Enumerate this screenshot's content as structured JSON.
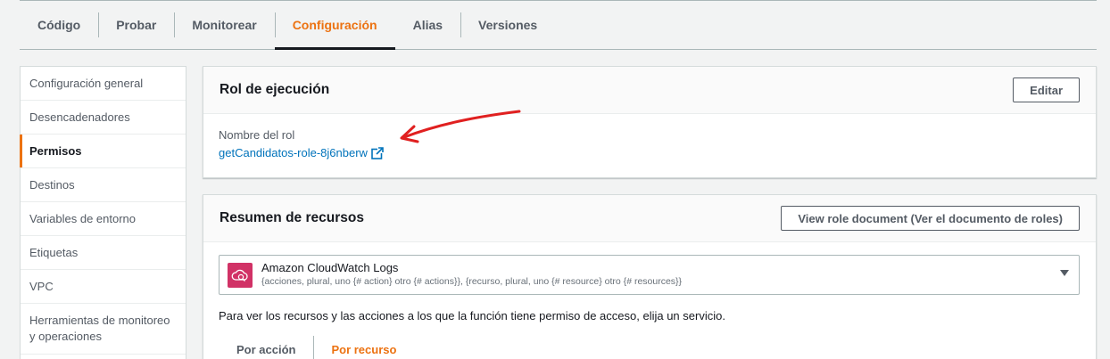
{
  "tabs": [
    "Código",
    "Probar",
    "Monitorear",
    "Configuración",
    "Alias",
    "Versiones"
  ],
  "active_tab": "Configuración",
  "sidebar": {
    "items": [
      "Configuración general",
      "Desencadenadores",
      "Permisos",
      "Destinos",
      "Variables de entorno",
      "Etiquetas",
      "VPC",
      "Herramientas de monitoreo y operaciones"
    ],
    "active": "Permisos"
  },
  "role_panel": {
    "title": "Rol de ejecución",
    "edit_label": "Editar",
    "role_name_label": "Nombre del rol",
    "role_name": "getCandidatos-role-8j6nberw",
    "external_link_icon": "external-link-icon"
  },
  "resources_panel": {
    "title": "Resumen de recursos",
    "view_doc_label": "View role document (Ver el documento de roles)",
    "service": {
      "name": "Amazon CloudWatch Logs",
      "description": "{acciones, plural, uno {# action} otro {# actions}}, {recurso, plural, uno {# resource} otro {# resources}}",
      "icon": "cloudwatch-icon"
    },
    "hint": "Para ver los recursos y las acciones a los que la función tiene permiso de acceso, elija un servicio.",
    "subtabs": [
      "Por acción",
      "Por recurso"
    ],
    "active_subtab": "Por recurso"
  },
  "colors": {
    "accent": "#ec7211",
    "link": "#0073bb",
    "annotation": "#e02020",
    "service_icon_bg": "#d13266"
  }
}
